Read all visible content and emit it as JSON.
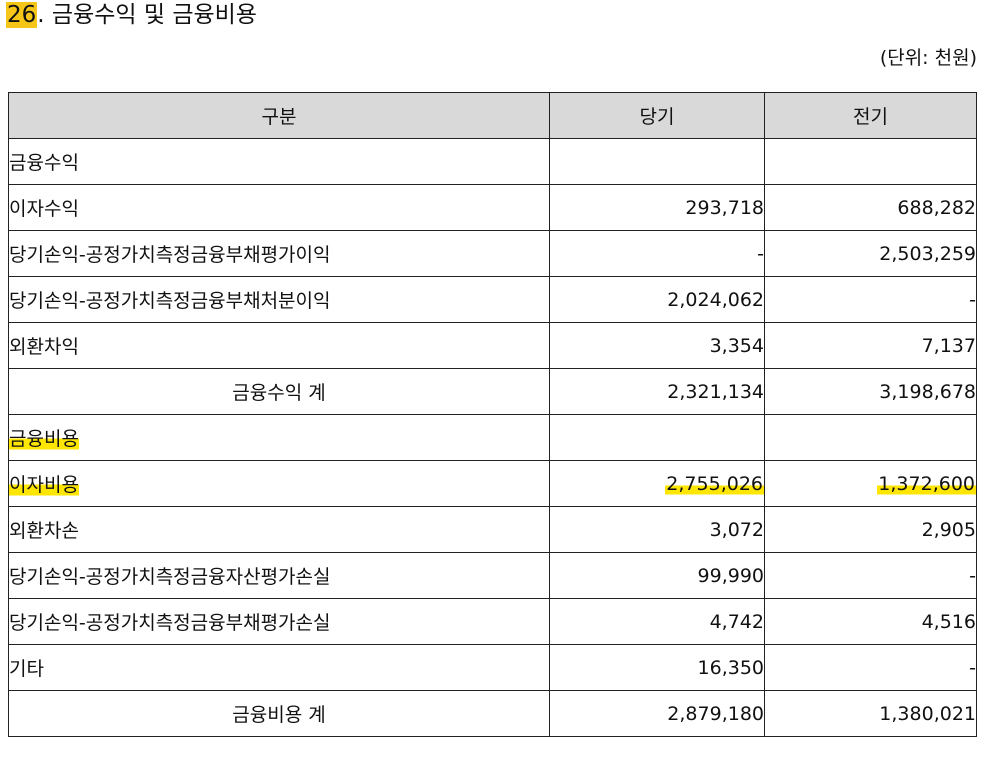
{
  "title": {
    "number": "26",
    "text": ". 금융수익 및 금융비용"
  },
  "unit_label": "(단위: 천원)",
  "table": {
    "headers": [
      "구분",
      "당기",
      "전기"
    ],
    "rows": [
      {
        "label": "금융수익",
        "current": "",
        "prior": "",
        "kind": "section"
      },
      {
        "label": "이자수익",
        "current": "293,718",
        "prior": "688,282",
        "kind": "item"
      },
      {
        "label": "당기손익-공정가치측정금융부채평가이익",
        "current": "-",
        "prior": "2,503,259",
        "kind": "item"
      },
      {
        "label": "당기손익-공정가치측정금융부채처분이익",
        "current": "2,024,062",
        "prior": "-",
        "kind": "item"
      },
      {
        "label": "외환차익",
        "current": "3,354",
        "prior": "7,137",
        "kind": "item"
      },
      {
        "label": "금융수익 계",
        "current": "2,321,134",
        "prior": "3,198,678",
        "kind": "total"
      },
      {
        "label": "금융비용",
        "current": "",
        "prior": "",
        "kind": "section"
      },
      {
        "label": "이자비용",
        "current": "2,755,026",
        "prior": "1,372,600",
        "kind": "item"
      },
      {
        "label": "외환차손",
        "current": "3,072",
        "prior": "2,905",
        "kind": "item"
      },
      {
        "label": "당기손익-공정가치측정금융자산평가손실",
        "current": "99,990",
        "prior": "-",
        "kind": "item"
      },
      {
        "label": "당기손익-공정가치측정금융부채평가손실",
        "current": "4,742",
        "prior": "4,516",
        "kind": "item"
      },
      {
        "label": "기타",
        "current": "16,350",
        "prior": "-",
        "kind": "item"
      },
      {
        "label": "금융비용 계",
        "current": "2,879,180",
        "prior": "1,380,021",
        "kind": "total"
      }
    ]
  },
  "highlight_color": "#ffe600",
  "title_number_highlight_color": "#f5c518",
  "header_background": "#d9d9d9"
}
